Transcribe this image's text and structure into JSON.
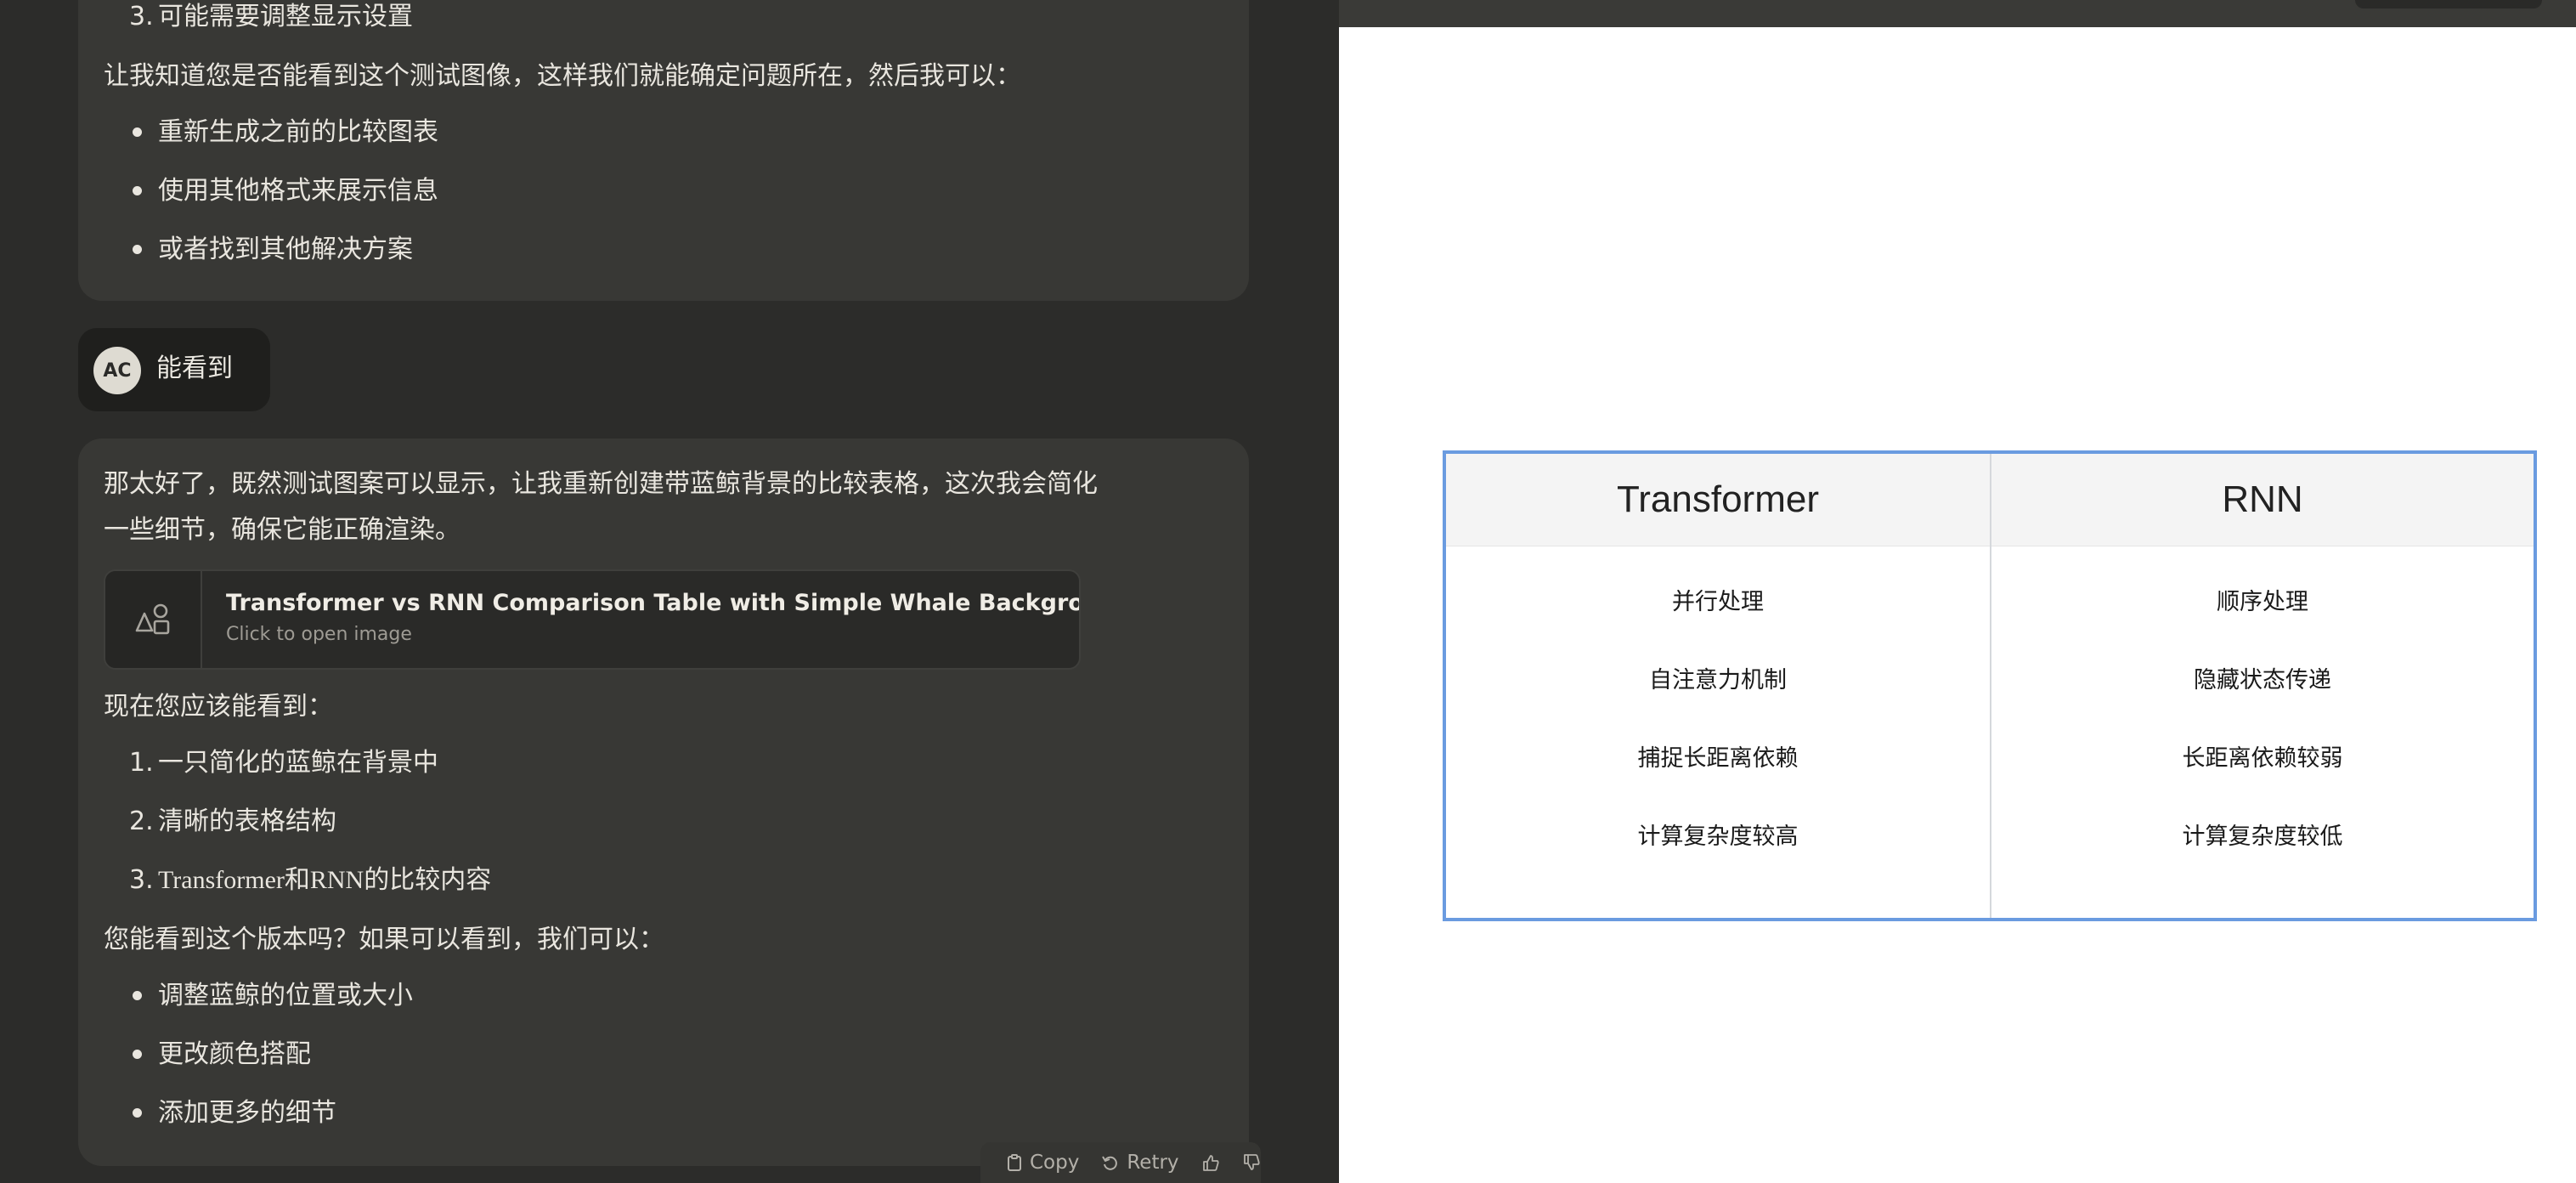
{
  "chat": {
    "prev_message": {
      "list_item_3_num": "3.",
      "list_item_3": "可能需要调整显示设置",
      "paragraph": "让我知道您是否能看到这个测试图像，这样我们就能确定问题所在，然后我可以：",
      "bullets": [
        "重新生成之前的比较图表",
        "使用其他格式来展示信息",
        "或者找到其他解决方案"
      ]
    },
    "user_message": {
      "avatar_initials": "AC",
      "text": "能看到"
    },
    "assistant_message": {
      "intro_line1": "那太好了，既然测试图案可以显示，让我重新创建带蓝鲸背景的比较表格，这次我会简化",
      "intro_line2": "一些细节，确保它能正确渲染。",
      "artifact": {
        "title": "Transformer vs RNN Comparison Table with Simple Whale Background",
        "subtitle": "Click to open image",
        "icon": "image-icon"
      },
      "see_heading": "现在您应该能看到：",
      "numbered": [
        {
          "num": "1.",
          "text": "一只简化的蓝鲸在背景中"
        },
        {
          "num": "2.",
          "text": "清晰的表格结构"
        },
        {
          "num": "3.",
          "text": "Transformer和RNN的比较内容"
        }
      ],
      "question": "您能看到这个版本吗？如果可以看到，我们可以：",
      "bullets": [
        "调整蓝鲸的位置或大小",
        "更改颜色搭配",
        "添加更多的细节"
      ]
    },
    "actions": {
      "copy": "Copy",
      "retry": "Retry"
    }
  },
  "preview": {
    "table": {
      "headers": [
        "Transformer",
        "RNN"
      ],
      "rows": [
        [
          "并行处理",
          "顺序处理"
        ],
        [
          "自注意力机制",
          "隐藏状态传递"
        ],
        [
          "捕捉长距离依赖",
          "长距离依赖较弱"
        ],
        [
          "计算复杂度较高",
          "计算复杂度较低"
        ]
      ],
      "border_color": "#6a9be0"
    }
  }
}
